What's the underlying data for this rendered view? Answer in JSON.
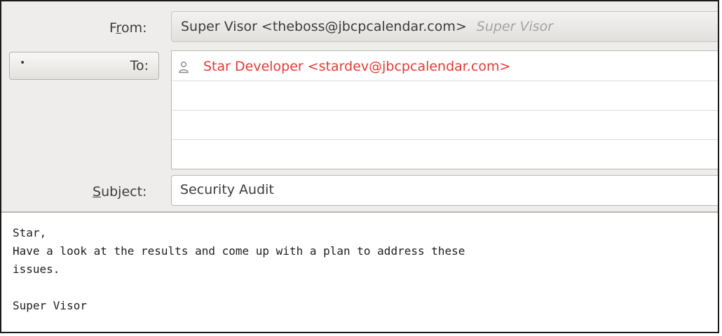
{
  "compose": {
    "from_label_pre": "F",
    "from_label_accel": "r",
    "from_label_post": "om:",
    "from_value": "Super Visor <theboss@jbcpcalendar.com>",
    "from_hint": "Super Visor",
    "to_dropdown_glyph": "•",
    "to_label": "To:",
    "recipients": [
      "Star Developer <stardev@jbcpcalendar.com>"
    ],
    "subject_label_accel": "S",
    "subject_label_post": "ubject:",
    "subject_value": "Security Audit"
  },
  "body": {
    "lines": [
      "Star,",
      "Have a look at the results and come up with a plan to address these",
      "issues.",
      "",
      "Super Visor"
    ]
  },
  "colors": {
    "recipient_text": "#e33b33",
    "header_background": "#efedeb",
    "placeholder_text": "#a5a3a0"
  },
  "icons": {
    "recipient": "person-icon"
  }
}
